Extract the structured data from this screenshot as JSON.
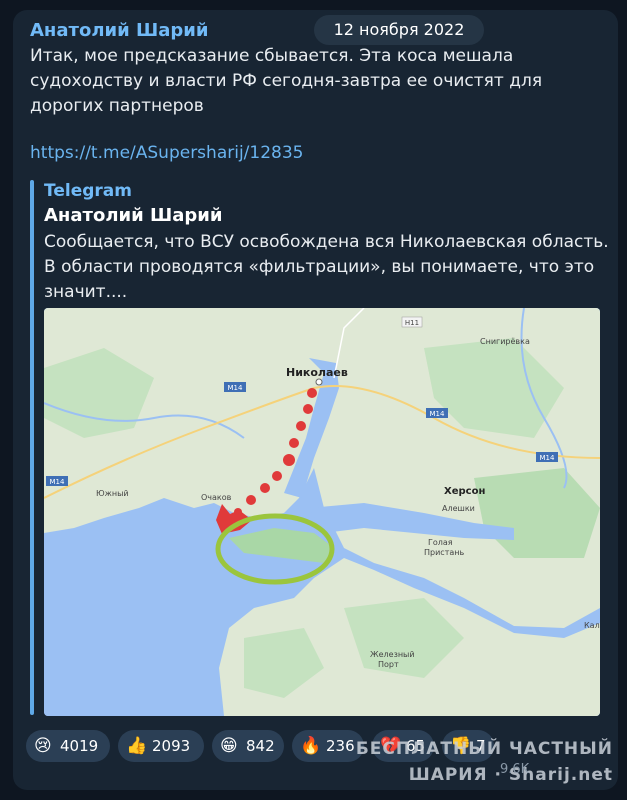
{
  "post": {
    "author": "Анатолий Шарий",
    "date": "12 ноября 2022",
    "text": "Итак, мое предсказание сбывается. Эта коса мешала судоходству и власти РФ сегодня-завтра ее очистят для дорогих партнеров",
    "link": "https://t.me/ASupersharij/12835"
  },
  "quote": {
    "source": "Telegram",
    "author": "Анатолий Шарий",
    "text": "Сообщается, что ВСУ освобождена вся Николаевская область. В области проводятся «фильтрации», вы понимаете, что это значит...."
  },
  "map": {
    "labels": {
      "nikolaev": "Николаев",
      "snigirevka": "Снигирёвка",
      "kherson": "Херсон",
      "aleshki": "Алешки",
      "golaya_pristan_1": "Голая",
      "golaya_pristan_2": "Пристань",
      "ochakov": "Очаков",
      "yuzhny": "Южный",
      "zhelezny_port_1": "Железный",
      "zhelezny_port_2": "Порт",
      "kala": "Кала",
      "m14_a": "M14",
      "m14_b": "M14",
      "m14_c": "M14",
      "m14_d": "M14",
      "h11": "H11"
    },
    "colors": {
      "land": "#dfe8d5",
      "green": "#a9d7a6",
      "water": "#9bc0f3",
      "route": "#e03a3a",
      "circle": "#9bc53d"
    }
  },
  "reactions": [
    {
      "emoji": "😢",
      "count": "4019"
    },
    {
      "emoji": "👍",
      "count": "2093"
    },
    {
      "emoji": "😁",
      "count": "842"
    },
    {
      "emoji": "🔥",
      "count": "236"
    },
    {
      "emoji": "💔",
      "count": "65"
    },
    {
      "emoji": "👎",
      "count": "7"
    }
  ],
  "watermark": {
    "line1": "БЕСПЛАТНЫЙ ЧАСТНЫЙ",
    "line2": "ШАРИЯ · Sharij.net"
  },
  "views": "9.6K"
}
